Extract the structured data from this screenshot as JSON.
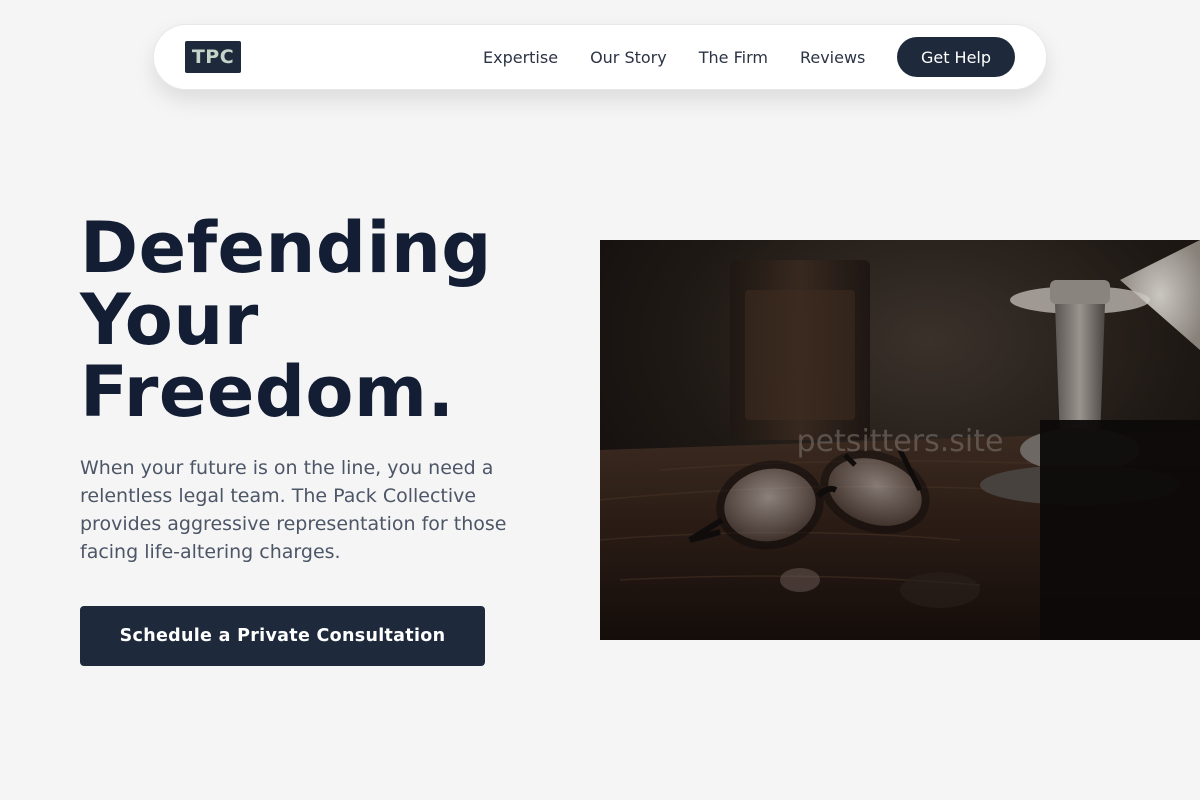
{
  "nav": {
    "logo": "TPC",
    "links": [
      "Expertise",
      "Our Story",
      "The Firm",
      "Reviews"
    ],
    "cta": "Get Help"
  },
  "hero": {
    "headline_lines": [
      "Defending",
      "Your",
      "Freedom."
    ],
    "subtext": "When your future is on the line, you need a relentless legal team. The Pack Collective provides aggressive representation for those facing life-altering charges.",
    "cta": "Schedule a Private Consultation",
    "image": {
      "subject": "glasses-on-wooden-desk-photo",
      "watermark": "petsitters.site"
    }
  },
  "colors": {
    "background": "#f5f5f5",
    "primary": "#1e2a3b",
    "headline": "#131d33",
    "body_text": "#4c5667",
    "logo_text": "#c6d3c9"
  }
}
